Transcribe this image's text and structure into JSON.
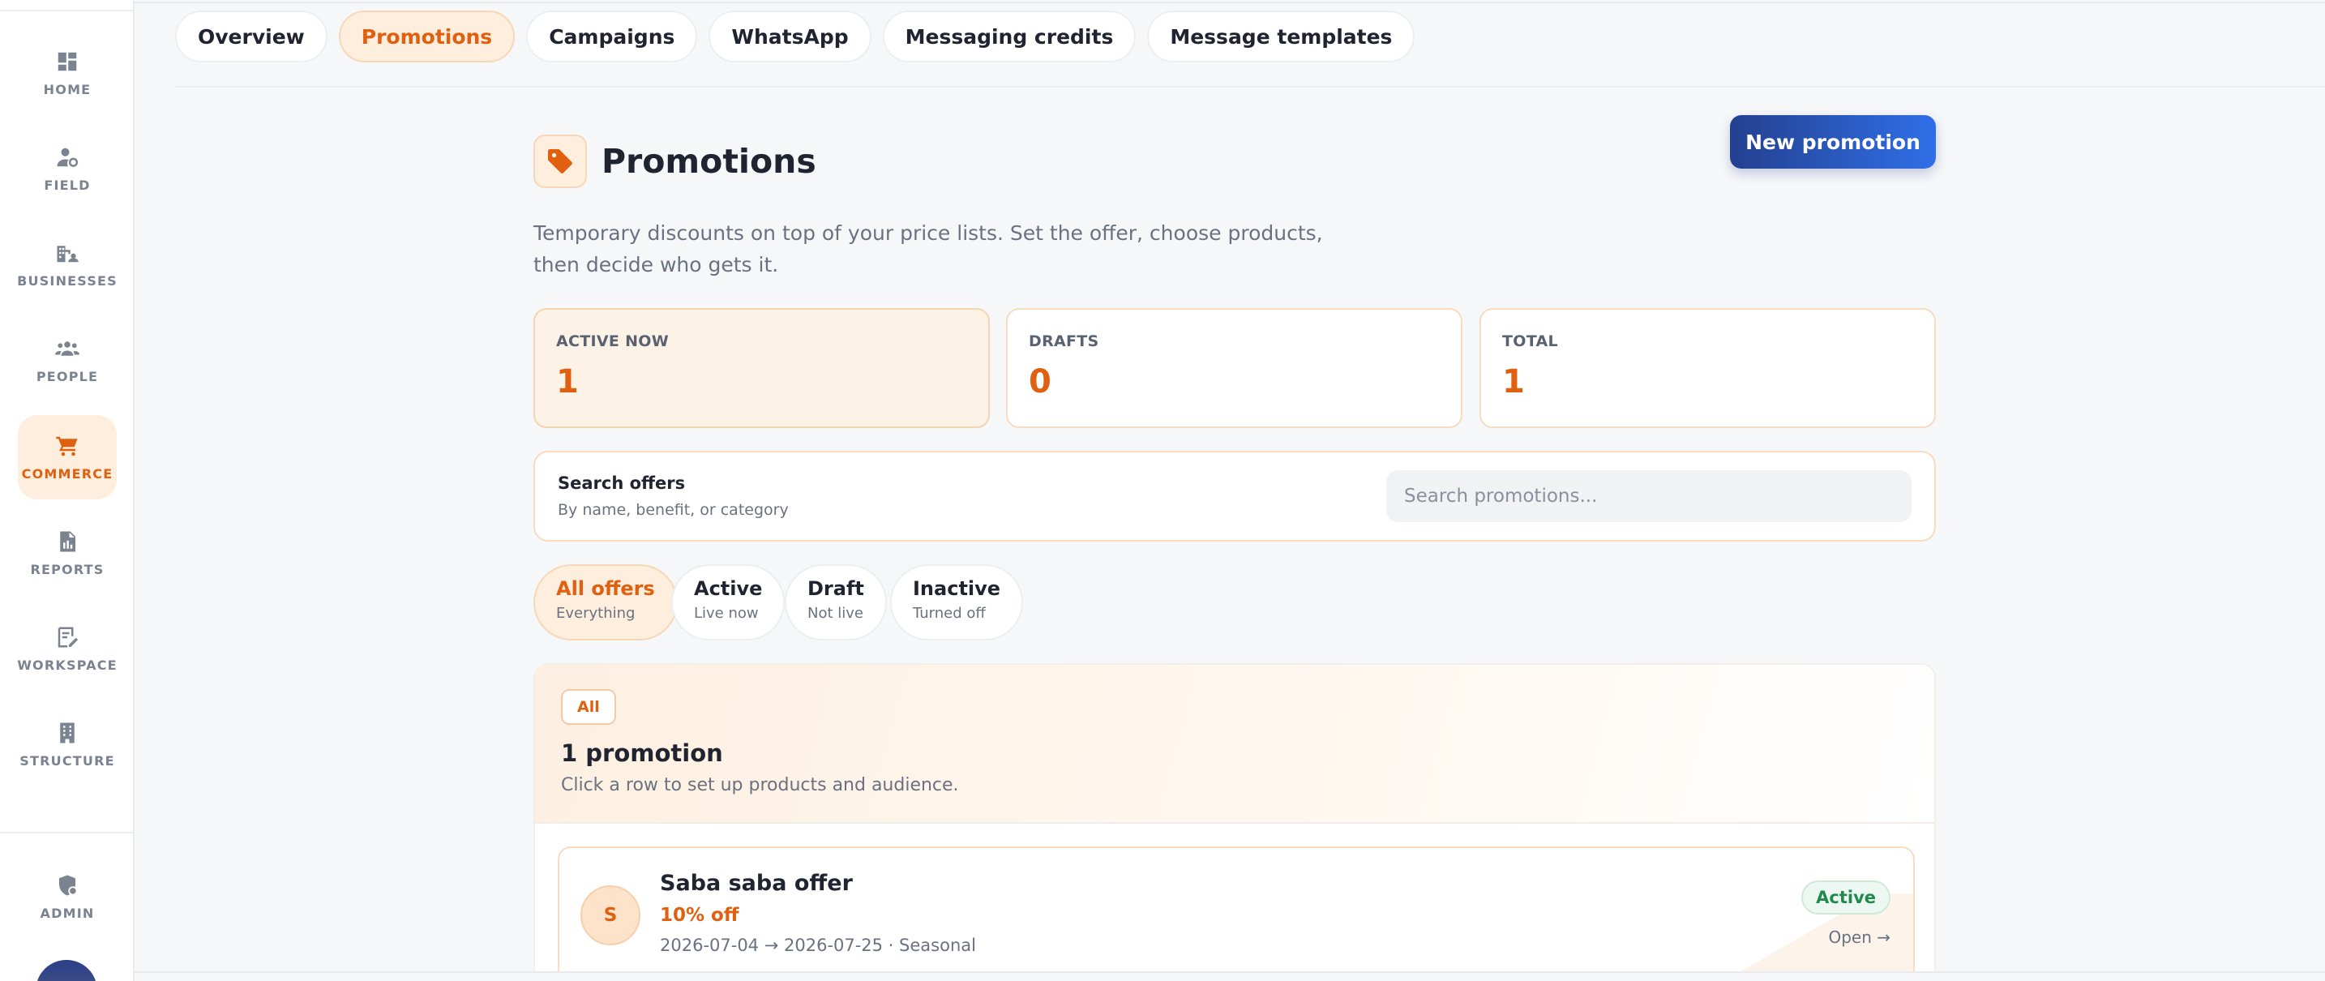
{
  "sidebar": {
    "items": [
      {
        "label": "HOME",
        "icon": "dashboard-icon"
      },
      {
        "label": "FIELD",
        "icon": "person-pin-icon"
      },
      {
        "label": "BUSINESSES",
        "icon": "buildings-icon"
      },
      {
        "label": "PEOPLE",
        "icon": "people-icon"
      },
      {
        "label": "COMMERCE",
        "icon": "cart-icon",
        "active": true
      },
      {
        "label": "REPORTS",
        "icon": "report-icon"
      },
      {
        "label": "WORKSPACE",
        "icon": "edit-note-icon"
      },
      {
        "label": "STRUCTURE",
        "icon": "building-icon"
      }
    ],
    "admin": {
      "label": "ADMIN",
      "icon": "shield-person-icon"
    }
  },
  "tabs": [
    {
      "label": "Overview"
    },
    {
      "label": "Promotions",
      "active": true
    },
    {
      "label": "Campaigns"
    },
    {
      "label": "WhatsApp"
    },
    {
      "label": "Messaging credits"
    },
    {
      "label": "Message templates"
    }
  ],
  "header": {
    "title": "Promotions",
    "title_icon": "tag-icon",
    "new_button": "New promotion",
    "subtitle_line1": "Temporary discounts on top of your price lists. Set the offer, choose products,",
    "subtitle_line2": "then decide who gets it."
  },
  "stats": [
    {
      "label": "ACTIVE NOW",
      "value": "1"
    },
    {
      "label": "DRAFTS",
      "value": "0"
    },
    {
      "label": "TOTAL",
      "value": "1"
    }
  ],
  "search": {
    "title": "Search offers",
    "subtitle": "By name, benefit, or category",
    "placeholder": "Search promotions..."
  },
  "filters": [
    {
      "title": "All offers",
      "sub": "Everything",
      "active": true
    },
    {
      "title": "Active",
      "sub": "Live now"
    },
    {
      "title": "Draft",
      "sub": "Not live"
    },
    {
      "title": "Inactive",
      "sub": "Turned off"
    }
  ],
  "list": {
    "badge": "All",
    "count": "1 promotion",
    "hint": "Click a row to set up products and audience.",
    "rows": [
      {
        "initial": "S",
        "name": "Saba saba offer",
        "benefit": "10% off",
        "meta": "2026-07-04 → 2026-07-25 · Seasonal",
        "status": "Active",
        "open": "Open →"
      }
    ]
  },
  "colors": {
    "accent": "#e0600f",
    "accent_soft": "#fdeedd",
    "primary_button": "#2f6fe8",
    "status_active": "#1f8a4c"
  }
}
